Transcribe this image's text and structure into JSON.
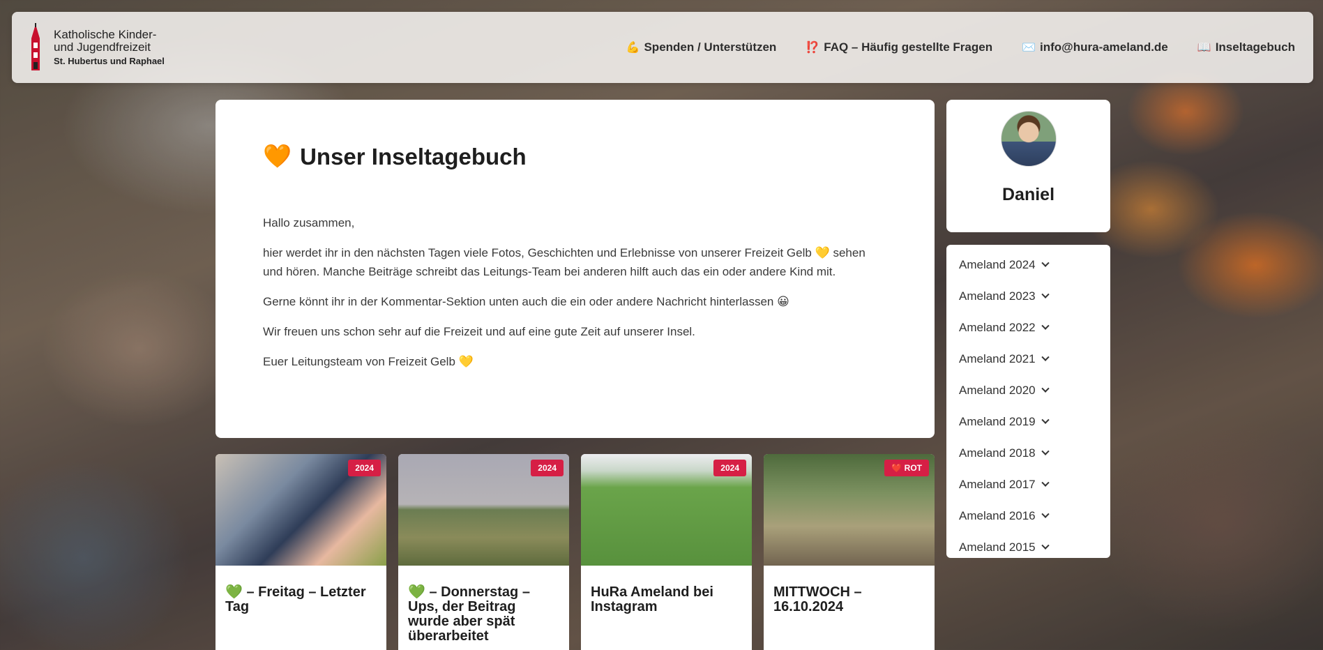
{
  "header": {
    "brand_line1": "Katholische Kinder-",
    "brand_line2": "und Jugendfreizeit",
    "brand_line3": "St. Hubertus und Raphael",
    "nav": [
      {
        "icon": "💪",
        "label": "Spenden / Unterstützen"
      },
      {
        "icon": "⁉️",
        "label": "FAQ – Häufig gestellte Fragen"
      },
      {
        "icon": "✉️",
        "label": "info@hura-ameland.de"
      },
      {
        "icon": "📖",
        "label": "Inseltagebuch"
      }
    ]
  },
  "main": {
    "title_icon": "🧡",
    "title": "Unser Inseltagebuch",
    "paragraphs": [
      "Hallo zusammen,",
      "hier werdet ihr in den nächsten Tagen viele Fotos, Geschichten und Erlebnisse von unserer Freizeit Gelb 💛 sehen und hören. Manche Beiträge schreibt das Leitungs-Team bei anderen hilft auch das ein oder andere Kind mit.",
      "Gerne könnt ihr in der Kommentar-Sektion unten auch die ein oder andere Nachricht hinterlassen 😀",
      "Wir freuen uns schon sehr auf die Freizeit und auf eine gute Zeit auf unserer Insel.",
      "Euer Leitungsteam von Freizeit Gelb 💛"
    ]
  },
  "profile": {
    "name": "Daniel"
  },
  "archive": [
    "Ameland 2024",
    "Ameland 2023",
    "Ameland 2022",
    "Ameland 2021",
    "Ameland 2020",
    "Ameland 2019",
    "Ameland 2018",
    "Ameland 2017",
    "Ameland 2016",
    "Ameland 2015"
  ],
  "posts": [
    {
      "badge": "2024",
      "title": "💚 – Freitag – Letzter Tag"
    },
    {
      "badge": "2024",
      "title": "💚 – Donnerstag – Ups, der Beitrag wurde aber spät überarbeitet"
    },
    {
      "badge": "2024",
      "title": "HuRa Ameland bei Instagram"
    },
    {
      "badge": "❤️ ROT",
      "title": "MITTWOCH – 16.10.2024"
    }
  ]
}
